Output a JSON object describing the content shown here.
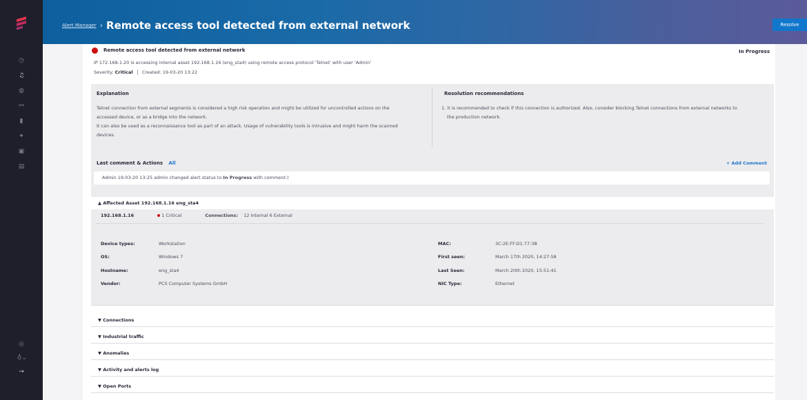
{
  "header": {
    "breadcrumb_link": "Alert Manager",
    "breadcrumb_sep": "›",
    "title": "Remote access tool detected from external network",
    "resolve_label": "Resolve"
  },
  "alert": {
    "title": "Remote access tool detected from external network",
    "status": "In Progress",
    "description": "IP 172.168.1.20 is accessing internal asset 192.168.1.16 (eng_sta4) using remote access protocol 'Telnet' with user 'Admin'",
    "severity_label": "Severity:",
    "severity_value": "Critical",
    "created": "Created: 19-03-20 13:22"
  },
  "explanation": {
    "title": "Explanation",
    "lines": [
      "Telnet connection from external segments is considered a high risk operation and might be utilized for uncontrolled actions on the",
      "accessed device, or as a bridge into the network.",
      "It can also be used as a reconnaissance tool as part of an attack. Usage of vulnerability tools is intrusive and might harm the scanned",
      "devices."
    ]
  },
  "resolution": {
    "title": "Resolution recommendations",
    "lines": [
      "1. it is recommended to check if this connection is authorized. Also, consider blocking Telnet connections from external networks to",
      "the production network."
    ]
  },
  "comments": {
    "title": "Last comment & Actions",
    "all_label": "All",
    "add_label": "+ Add Comment",
    "entry_prefix": "Admin 19-03-20 13:25   admin changed alert status to ",
    "entry_status": "In Progress",
    "entry_suffix": " with comment:)"
  },
  "asset": {
    "header": "▲ Affected Asset 192.168.1.16 eng_sta4",
    "ip": "192.168.1.16",
    "critical": "1 Critical",
    "connections_label": "Connections:",
    "connections_value": "12 Internal 6 External",
    "details_left": [
      {
        "label": "Device types:",
        "value": "Workstation"
      },
      {
        "label": "OS:",
        "value": "Windows 7"
      },
      {
        "label": "Hostname:",
        "value": "eng_sta4"
      },
      {
        "label": "Vendor:",
        "value": "PCS Computer Systems GmbH"
      }
    ],
    "details_right": [
      {
        "label": "MAC:",
        "value": "3C:2E:FF:D1:77:3B"
      },
      {
        "label": "First seen:",
        "value": "March 17th 2020, 14:27:58"
      },
      {
        "label": "Last Seen:",
        "value": "March 20th 2020, 15:51:41"
      },
      {
        "label": "NIC Type:",
        "value": "Ethernet"
      }
    ]
  },
  "sections": [
    "▼ Connections",
    "▼ Industrial traffic",
    "▼ Anomalies",
    "▼ Activity and alerts log",
    "▼ Open Ports"
  ],
  "colors": {
    "accent": "#1177cc",
    "critical": "#cc1111",
    "sidebar": "#1f1f2b"
  }
}
